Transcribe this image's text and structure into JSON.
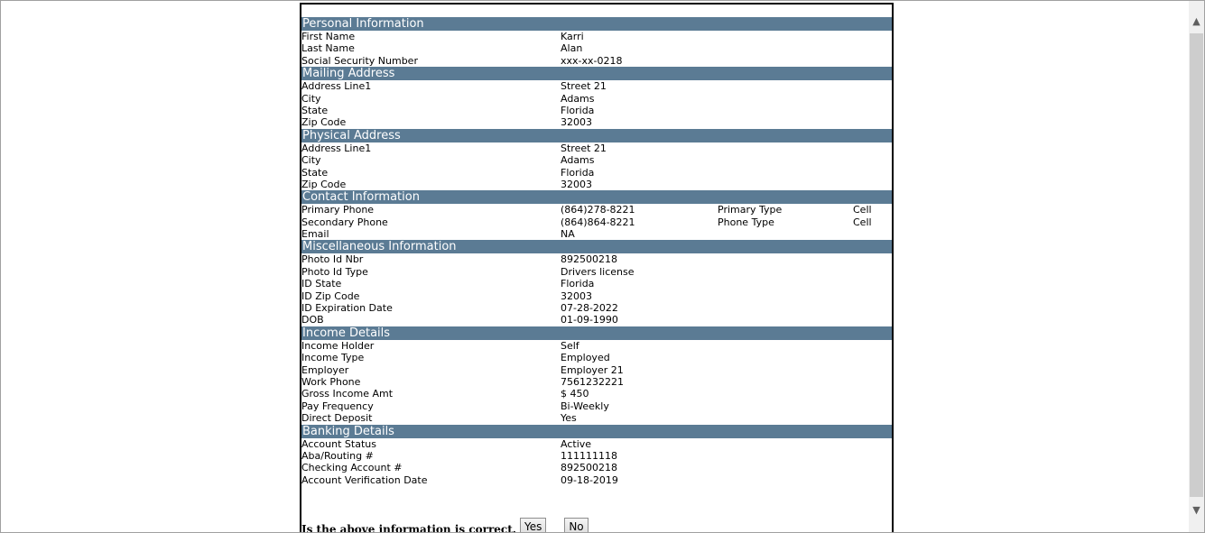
{
  "sections": [
    {
      "title": "Personal Information",
      "rows": [
        {
          "label": "First Name",
          "value": "Karri"
        },
        {
          "label": "Last Name",
          "value": "Alan"
        },
        {
          "label": "Social Security Number",
          "value": "xxx-xx-0218"
        }
      ]
    },
    {
      "title": "Mailing Address",
      "rows": [
        {
          "label": "Address Line1",
          "value": "Street 21"
        },
        {
          "label": "City",
          "value": "Adams"
        },
        {
          "label": "State",
          "value": "Florida"
        },
        {
          "label": "Zip Code",
          "value": "32003"
        }
      ]
    },
    {
      "title": "Physical Address",
      "rows": [
        {
          "label": "Address Line1",
          "value": "Street 21"
        },
        {
          "label": "City",
          "value": "Adams"
        },
        {
          "label": "State",
          "value": "Florida"
        },
        {
          "label": "Zip Code",
          "value": "32003"
        }
      ]
    },
    {
      "title": "Contact Information",
      "rows": [
        {
          "label": "Primary Phone",
          "value": "(864)278-8221",
          "label2": "Primary Type",
          "value2": "Cell"
        },
        {
          "label": "Secondary Phone",
          "value": "(864)864-8221",
          "label2": "Phone Type",
          "value2": "Cell"
        },
        {
          "label": "Email",
          "value": "NA"
        }
      ]
    },
    {
      "title": "Miscellaneous Information",
      "rows": [
        {
          "label": "Photo Id Nbr",
          "value": "892500218"
        },
        {
          "label": "Photo Id Type",
          "value": "Drivers license"
        },
        {
          "label": "ID State",
          "value": "Florida"
        },
        {
          "label": "ID Zip Code",
          "value": "32003"
        },
        {
          "label": "ID Expiration Date",
          "value": "07-28-2022"
        },
        {
          "label": "DOB",
          "value": "01-09-1990"
        }
      ]
    },
    {
      "title": "Income Details",
      "rows": [
        {
          "label": "Income Holder",
          "value": "Self"
        },
        {
          "label": "Income Type",
          "value": "Employed"
        },
        {
          "label": "Employer",
          "value": "Employer 21"
        },
        {
          "label": "Work Phone",
          "value": "7561232221"
        },
        {
          "label": "Gross Income Amt",
          "value": "$ 450"
        },
        {
          "label": "Pay Frequency",
          "value": "Bi-Weekly"
        },
        {
          "label": "Direct Deposit",
          "value": "Yes"
        }
      ]
    },
    {
      "title": "Banking Details",
      "rows": [
        {
          "label": "Account Status",
          "value": "Active"
        },
        {
          "label": "Aba/Routing #",
          "value": "111111118"
        },
        {
          "label": "Checking Account #",
          "value": "892500218"
        },
        {
          "label": "Account Verification Date",
          "value": "09-18-2019"
        }
      ]
    }
  ],
  "confirm": {
    "question": "Is the above information is correct.",
    "yes_label": "Yes",
    "no_label": "No"
  },
  "scrollbar": {
    "up_icon": "chevron-up-icon",
    "down_icon": "chevron-down-icon"
  }
}
